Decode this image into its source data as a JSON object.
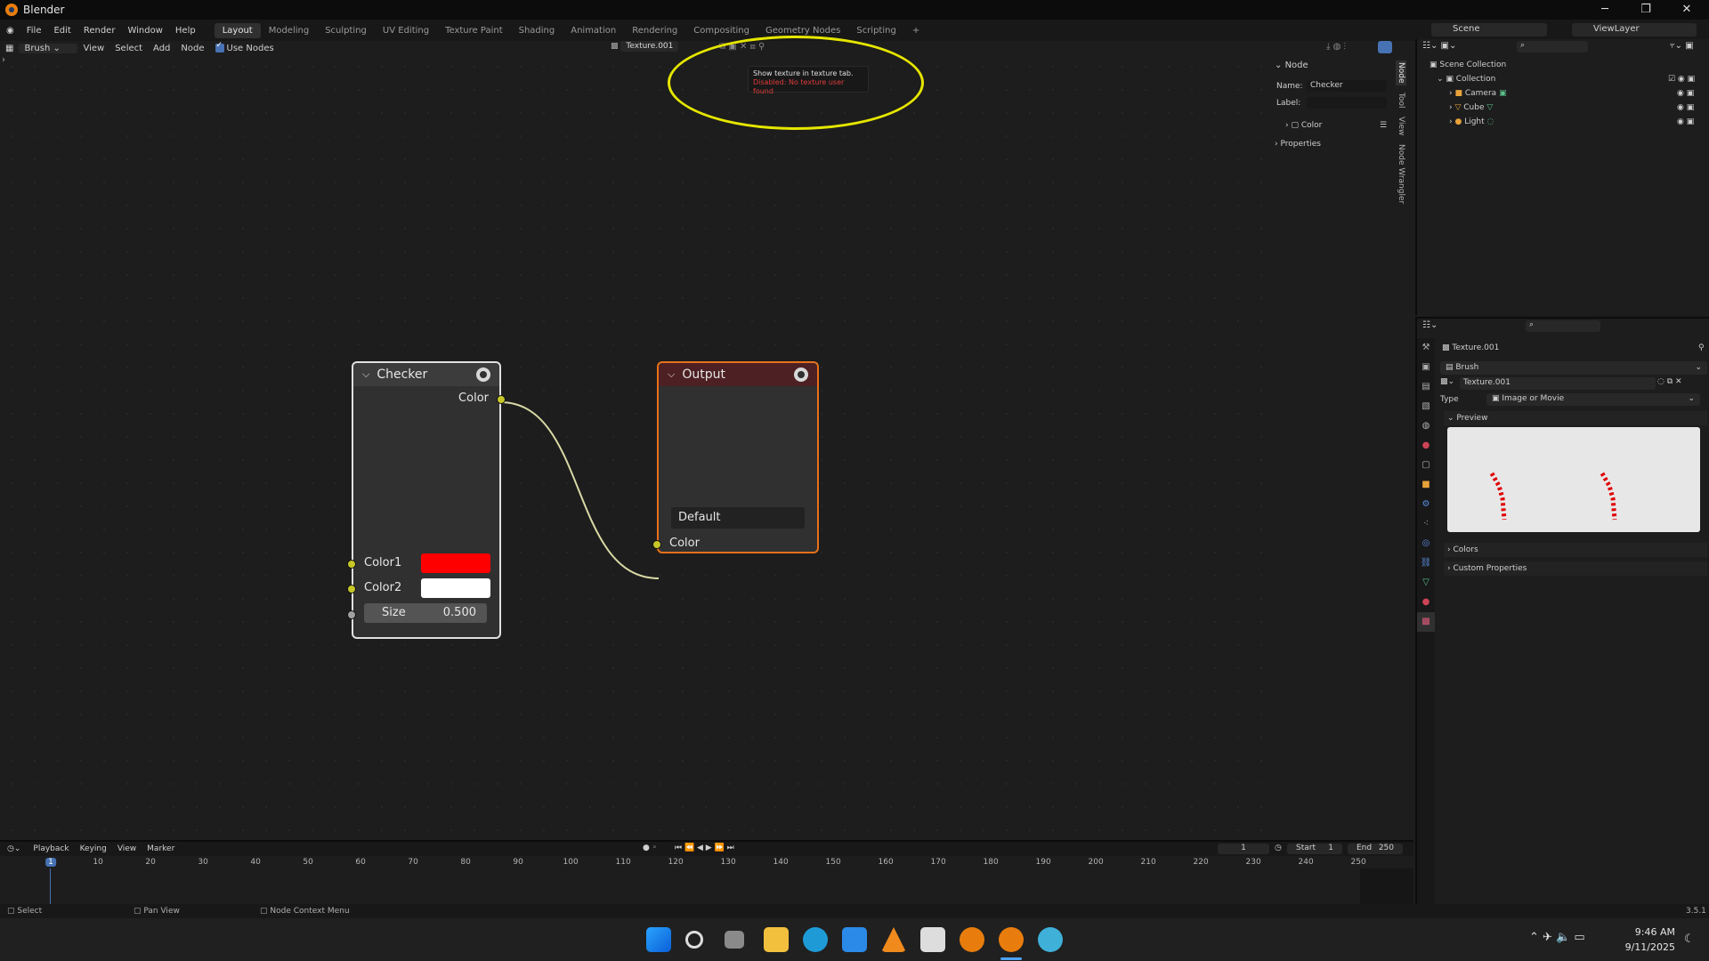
{
  "app": {
    "title": "Blender",
    "version": "3.5.1"
  },
  "menu": [
    "File",
    "Edit",
    "Render",
    "Window",
    "Help"
  ],
  "workspaces": [
    "Layout",
    "Modeling",
    "Sculpting",
    "UV Editing",
    "Texture Paint",
    "Shading",
    "Animation",
    "Rendering",
    "Compositing",
    "Geometry Nodes",
    "Scripting"
  ],
  "active_workspace": "Layout",
  "scene": {
    "label": "Scene",
    "view_layer": "ViewLayer"
  },
  "node_header": {
    "texture_type": "Brush",
    "items": [
      "View",
      "Select",
      "Add",
      "Node"
    ],
    "use_nodes": "Use Nodes",
    "texture_name": "Texture.001"
  },
  "tooltip": {
    "line1": "Show texture in texture tab.",
    "line2": "Disabled: No texture user found"
  },
  "nodes": {
    "checker": {
      "title": "Checker",
      "output": "Color",
      "inputs": {
        "color1": "Color1",
        "color2": "Color2",
        "size_label": "Size",
        "size_value": "0.500"
      },
      "color1_hex": "#ff0000",
      "color2_hex": "#ffffff"
    },
    "output": {
      "title": "Output",
      "name_field": "Default",
      "input": "Color"
    }
  },
  "npanel": {
    "section": "Node",
    "name_label": "Name:",
    "name_value": "Checker",
    "label_label": "Label:",
    "color_section": "Color",
    "properties_section": "Properties",
    "tabs": [
      "Node",
      "Tool",
      "View",
      "Node Wrangler"
    ]
  },
  "outliner": {
    "root": "Scene Collection",
    "collection": "Collection",
    "items": [
      "Camera",
      "Cube",
      "Light"
    ]
  },
  "properties": {
    "texture_title": "Texture.001",
    "context": "Brush",
    "texture_datablock": "Texture.001",
    "type_label": "Type",
    "type_value": "Image or Movie",
    "preview_section": "Preview",
    "colors_section": "Colors",
    "custom_section": "Custom Properties"
  },
  "timeline": {
    "menus": [
      "Playback",
      "Keying",
      "View",
      "Marker"
    ],
    "current_frame": "1",
    "start_label": "Start",
    "start": "1",
    "end_label": "End",
    "end": "250",
    "ticks": [
      "1",
      "10",
      "20",
      "30",
      "40",
      "50",
      "60",
      "70",
      "80",
      "90",
      "100",
      "110",
      "120",
      "130",
      "140",
      "150",
      "160",
      "170",
      "180",
      "190",
      "200",
      "210",
      "220",
      "230",
      "240",
      "250"
    ]
  },
  "statusbar": {
    "select": "Select",
    "pan": "Pan View",
    "context": "Node Context Menu"
  },
  "taskbar": {
    "time": "9:46 AM",
    "date": "9/11/2025"
  },
  "colors": {
    "accent": "#4772b3",
    "socket": "#c7c729",
    "node_output_header": "#4d2023",
    "highlight": "#e6e600"
  }
}
